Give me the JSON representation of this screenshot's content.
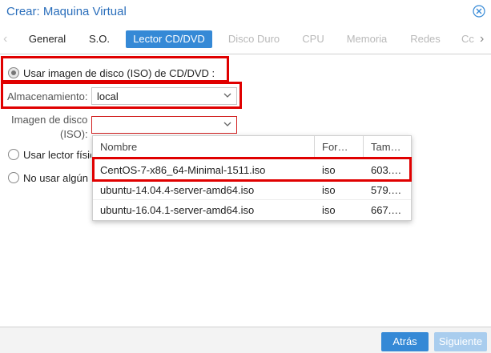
{
  "window": {
    "title": "Crear: Maquina Virtual"
  },
  "tabs": [
    {
      "label": "General",
      "state": "normal"
    },
    {
      "label": "S.O.",
      "state": "normal"
    },
    {
      "label": "Lector CD/DVD",
      "state": "active"
    },
    {
      "label": "Disco Duro",
      "state": "disabled"
    },
    {
      "label": "CPU",
      "state": "disabled"
    },
    {
      "label": "Memoria",
      "state": "disabled"
    },
    {
      "label": "Redes",
      "state": "disabled"
    },
    {
      "label": "Cc",
      "state": "disabled"
    }
  ],
  "form": {
    "option_iso_label": "Usar imagen de disco (ISO) de CD/DVD :",
    "storage_label": "Almacenamiento:",
    "storage_value": "local",
    "iso_label_line1": "Imagen de disco",
    "iso_label_line2": "(ISO):",
    "iso_value": "",
    "option_physical_label": "Usar lector físic",
    "option_none_label": "No usar algún"
  },
  "iso_dropdown": {
    "columns": [
      "Nombre",
      "For…",
      "Tam…"
    ],
    "rows": [
      {
        "name": "CentOS-7-x86_64-Minimal-1511.iso",
        "format": "iso",
        "size": "603.…"
      },
      {
        "name": "ubuntu-14.04.4-server-amd64.iso",
        "format": "iso",
        "size": "579.…"
      },
      {
        "name": "ubuntu-16.04.1-server-amd64.iso",
        "format": "iso",
        "size": "667.…"
      }
    ]
  },
  "footer": {
    "back_label": "Atrás",
    "next_label": "Siguiente"
  },
  "colors": {
    "accent": "#3589d6",
    "title": "#2a6ebb",
    "highlight": "#e00000"
  }
}
